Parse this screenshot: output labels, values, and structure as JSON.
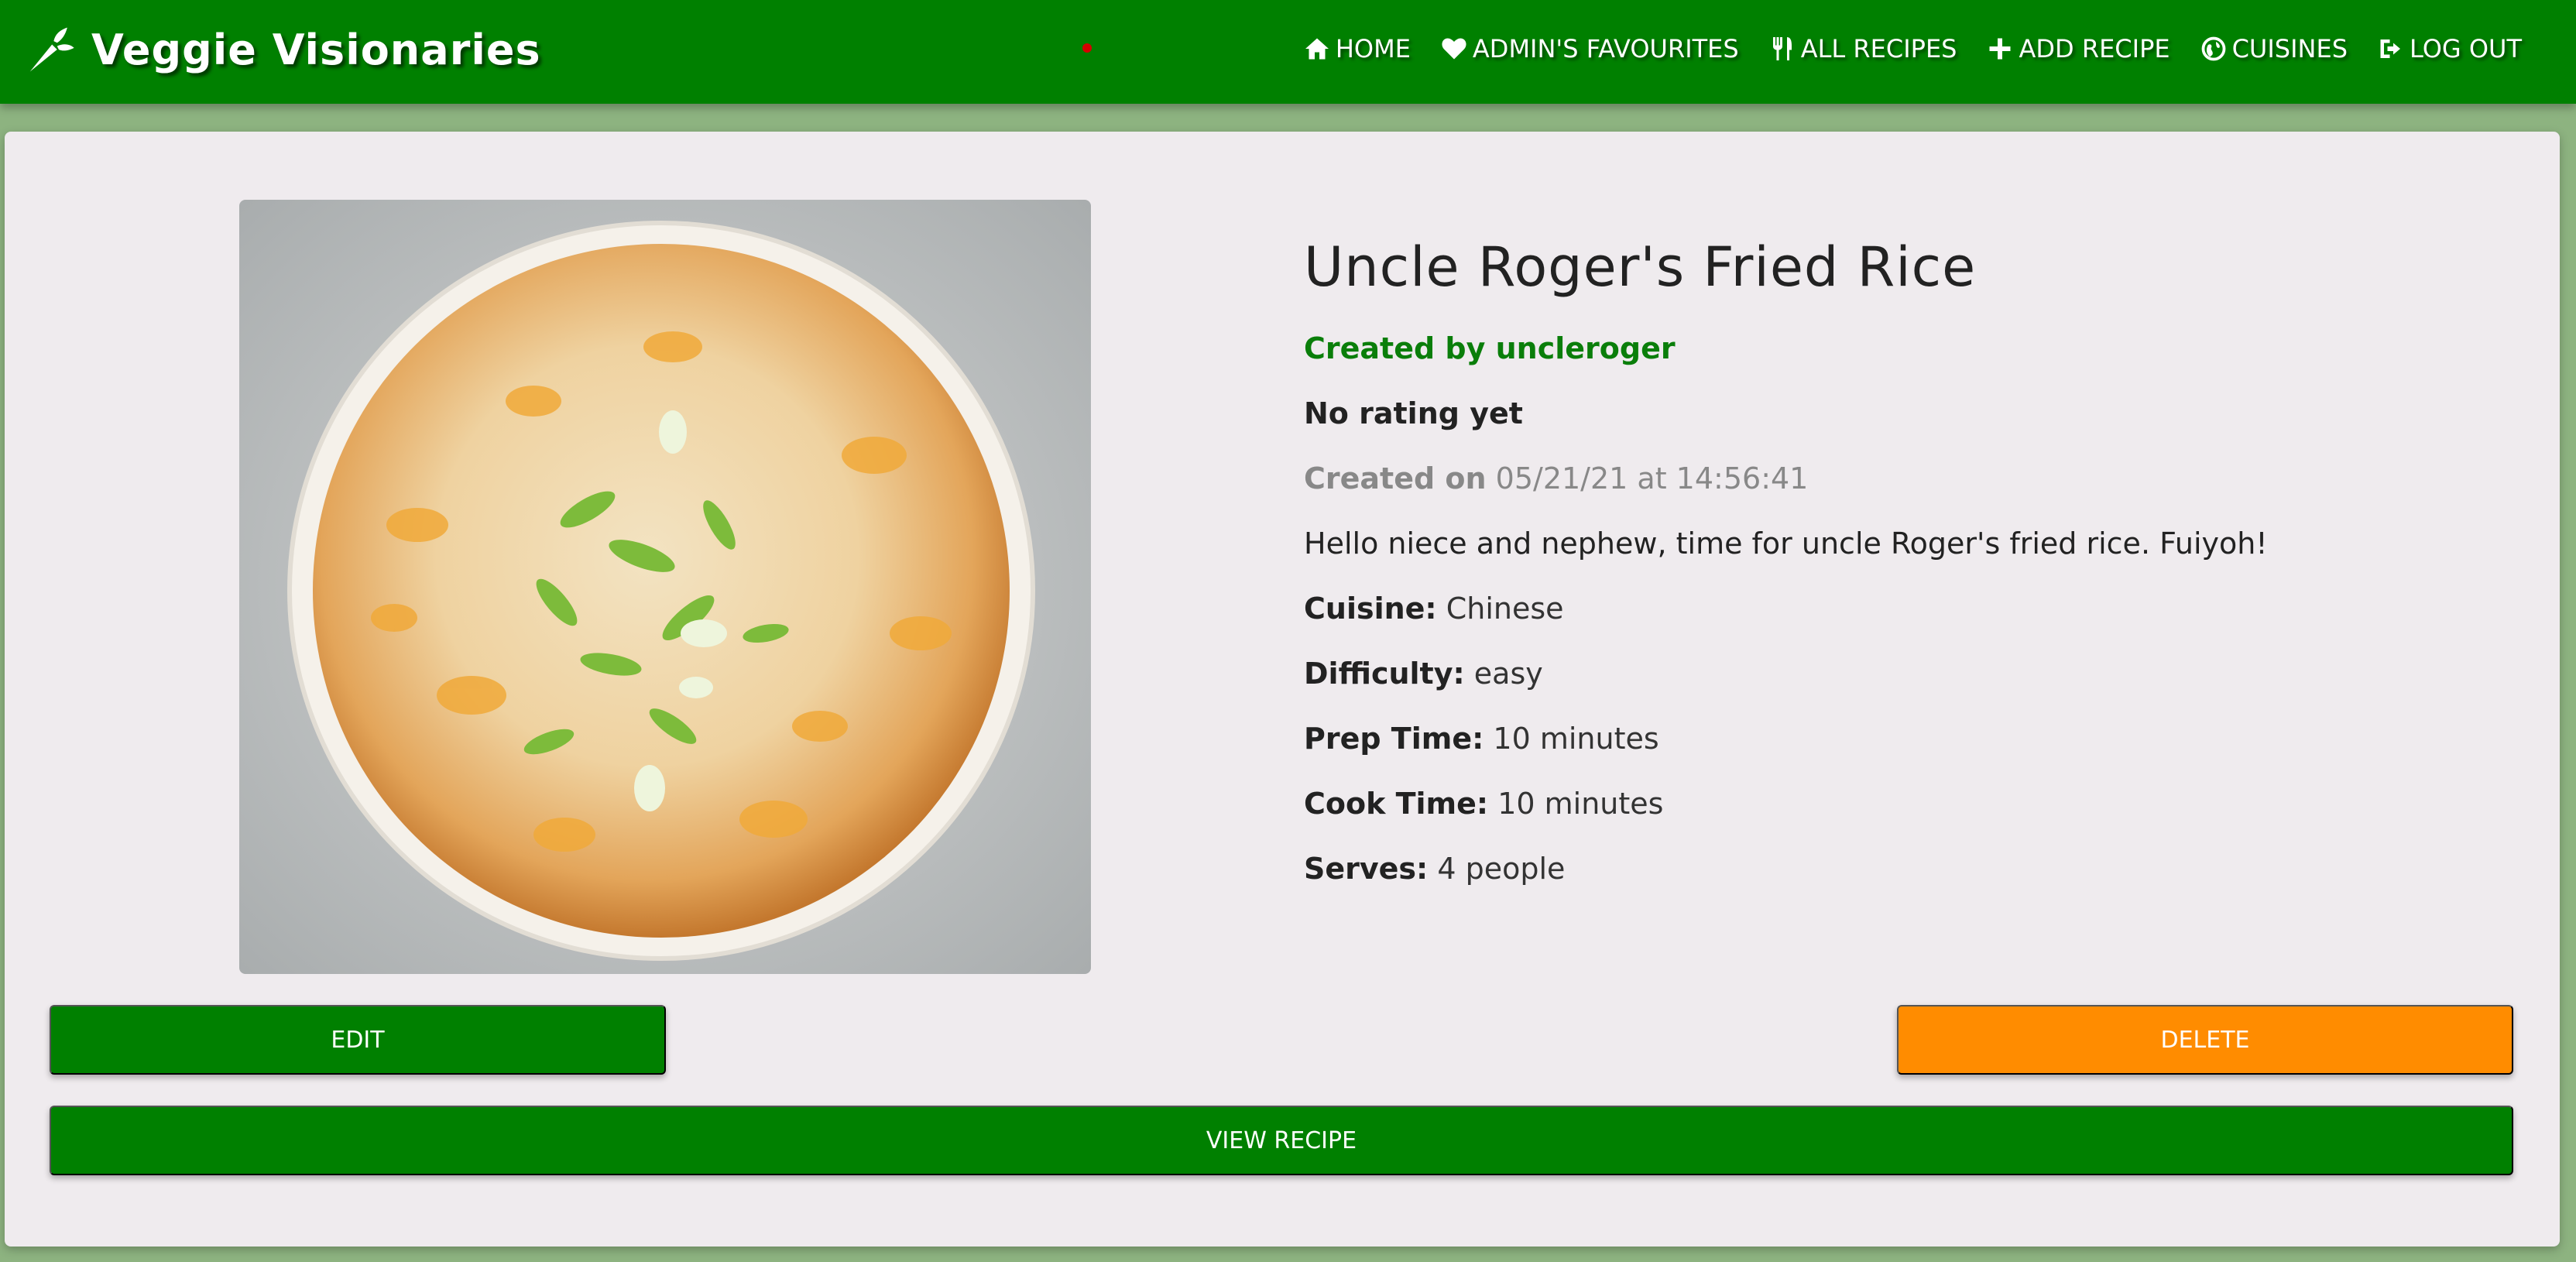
{
  "navbar": {
    "brand": "Veggie Visionaries",
    "brand_icon": "carrot-icon",
    "links": [
      {
        "label": "HOME",
        "icon": "home-icon"
      },
      {
        "label": "ADMIN'S FAVOURITES",
        "icon": "heart-icon"
      },
      {
        "label": "ALL RECIPES",
        "icon": "utensils-icon"
      },
      {
        "label": "ADD RECIPE",
        "icon": "plus-icon"
      },
      {
        "label": "CUISINES",
        "icon": "globe-icon"
      },
      {
        "label": "LOG OUT",
        "icon": "sign-out-icon"
      }
    ],
    "color": "#008000"
  },
  "recipe": {
    "title": "Uncle Roger's Fried Rice",
    "author": "Created by uncleroger",
    "rating": "No rating yet",
    "created_label": "Created on",
    "created_value": "05/21/21 at 14:56:41",
    "description": "Hello niece and nephew, time for uncle Roger's fried rice. Fuiyoh!",
    "fields": [
      {
        "label": "Cuisine:",
        "value": "Chinese"
      },
      {
        "label": "Difficulty:",
        "value": "easy"
      },
      {
        "label": "Prep Time:",
        "value": "10 minutes"
      },
      {
        "label": "Cook Time:",
        "value": "10 minutes"
      },
      {
        "label": "Serves:",
        "value": "4 people"
      }
    ]
  },
  "buttons": {
    "edit": "EDIT",
    "delete": "DELETE",
    "view": "VIEW RECIPE"
  },
  "colors": {
    "primary": "#008000",
    "danger": "#ff8c00",
    "page_bg": "#8db380",
    "card_bg": "#efebee"
  }
}
